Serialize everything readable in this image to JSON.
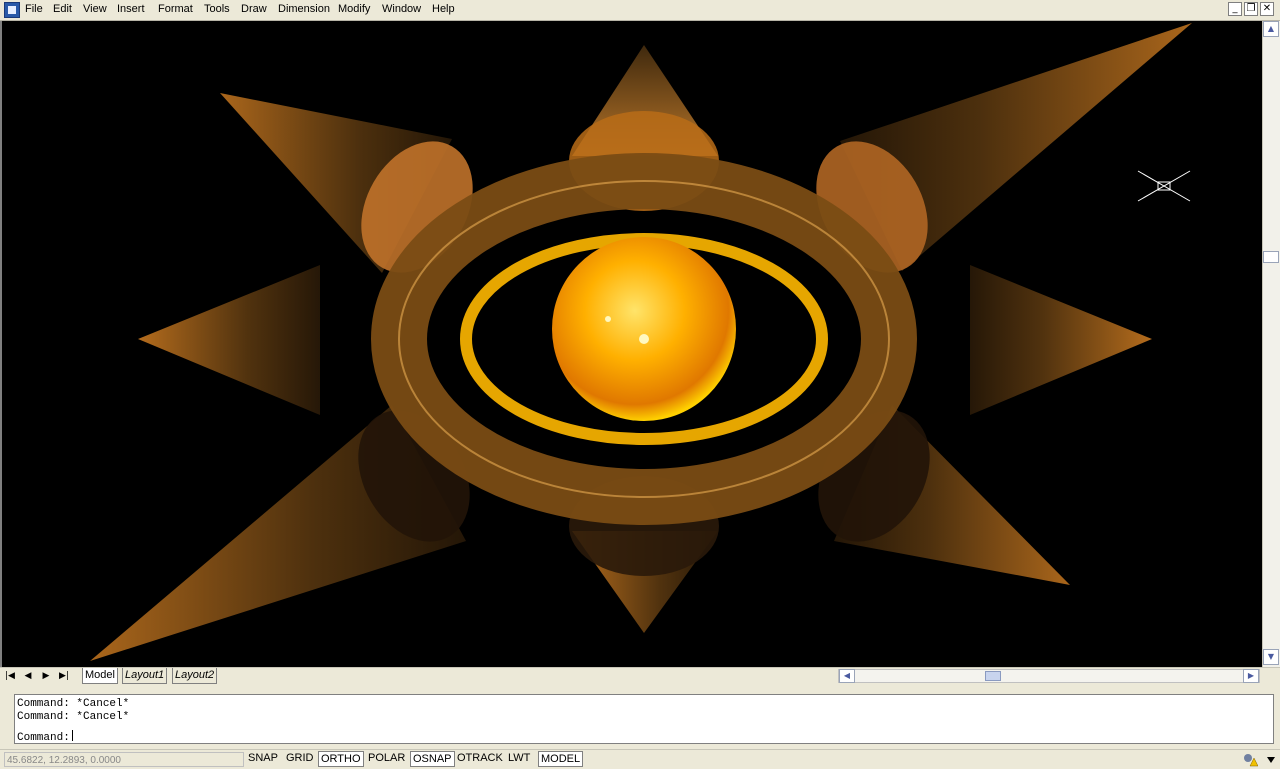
{
  "menubar": {
    "app_icon": "autocad-icon",
    "items": [
      "File",
      "Edit",
      "View",
      "Insert",
      "Format",
      "Tools",
      "Draw",
      "Dimension",
      "Modify",
      "Window",
      "Help"
    ],
    "window_controls": {
      "minimize": "_",
      "restore": "❐",
      "close": "✕"
    }
  },
  "viewport": {
    "background": "#000000",
    "accent": "#e89a30",
    "glow": "#ffd000",
    "crosshair_icon": "crosshair-icon"
  },
  "tabs": {
    "nav": [
      "|◀",
      "◀",
      "▶",
      "▶|"
    ],
    "items": [
      "Model",
      "Layout1",
      "Layout2"
    ],
    "active": "Model"
  },
  "command": {
    "history": [
      "Command: *Cancel*",
      "Command: *Cancel*"
    ],
    "prompt": "Command:"
  },
  "status": {
    "coords": "45.6822, 12.2893, 0.0000",
    "toggles": [
      {
        "label": "SNAP",
        "on": false
      },
      {
        "label": "GRID",
        "on": false
      },
      {
        "label": "ORTHO",
        "on": true
      },
      {
        "label": "POLAR",
        "on": false
      },
      {
        "label": "OSNAP",
        "on": true
      },
      {
        "label": "OTRACK",
        "on": false
      },
      {
        "label": "LWT",
        "on": false
      },
      {
        "label": "MODEL",
        "on": true
      }
    ]
  }
}
